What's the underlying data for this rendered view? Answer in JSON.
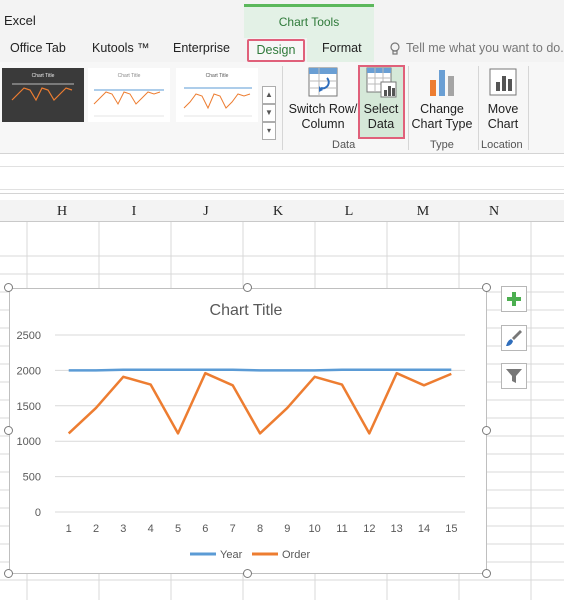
{
  "app": {
    "name": "Excel"
  },
  "ribbon": {
    "context_tab": "Chart Tools",
    "tabs": [
      "Office Tab",
      "Kutools ™",
      "Enterprise",
      "Design",
      "Format"
    ],
    "tell_me": "Tell me what you want to do..",
    "buttons": {
      "switch_row_column": [
        "Switch Row/",
        "Column"
      ],
      "select_data": [
        "Select",
        "Data"
      ],
      "change_chart_type": [
        "Change",
        "Chart Type"
      ],
      "move_chart": [
        "Move",
        "Chart"
      ]
    },
    "groups": {
      "data": "Data",
      "type": "Type",
      "location": "Location"
    },
    "gallery_thumb_titles": [
      "Chart Title",
      "Chart Title",
      "Chart Title"
    ]
  },
  "grid": {
    "columns": [
      "H",
      "I",
      "J",
      "K",
      "L",
      "M",
      "N"
    ]
  },
  "colors": {
    "year_series": "#5b9bd5",
    "order_series": "#ed7d31",
    "accent_green": "#5cb85c",
    "highlight_border": "#e0607a"
  },
  "icons": [
    "bulb-icon",
    "switch-row-column-icon",
    "select-data-icon",
    "change-chart-type-icon",
    "move-chart-icon",
    "plus-icon",
    "brush-icon",
    "filter-icon"
  ],
  "chart_data": {
    "type": "line",
    "title": "Chart Title",
    "categories": [
      1,
      2,
      3,
      4,
      5,
      6,
      7,
      8,
      9,
      10,
      11,
      12,
      13,
      14,
      15
    ],
    "series": [
      {
        "name": "Year",
        "values": [
          2000,
          2000,
          2010,
          2010,
          2010,
          2010,
          2010,
          2000,
          2000,
          2000,
          2010,
          2010,
          2010,
          2010,
          2010
        ]
      },
      {
        "name": "Order",
        "values": [
          1110,
          1470,
          1910,
          1800,
          1110,
          1960,
          1790,
          1110,
          1470,
          1910,
          1800,
          1110,
          1960,
          1790,
          1950
        ]
      }
    ],
    "ylim": [
      0,
      2500
    ],
    "yticks": [
      0,
      500,
      1000,
      1500,
      2000,
      2500
    ],
    "grid": true,
    "legend": "bottom"
  }
}
